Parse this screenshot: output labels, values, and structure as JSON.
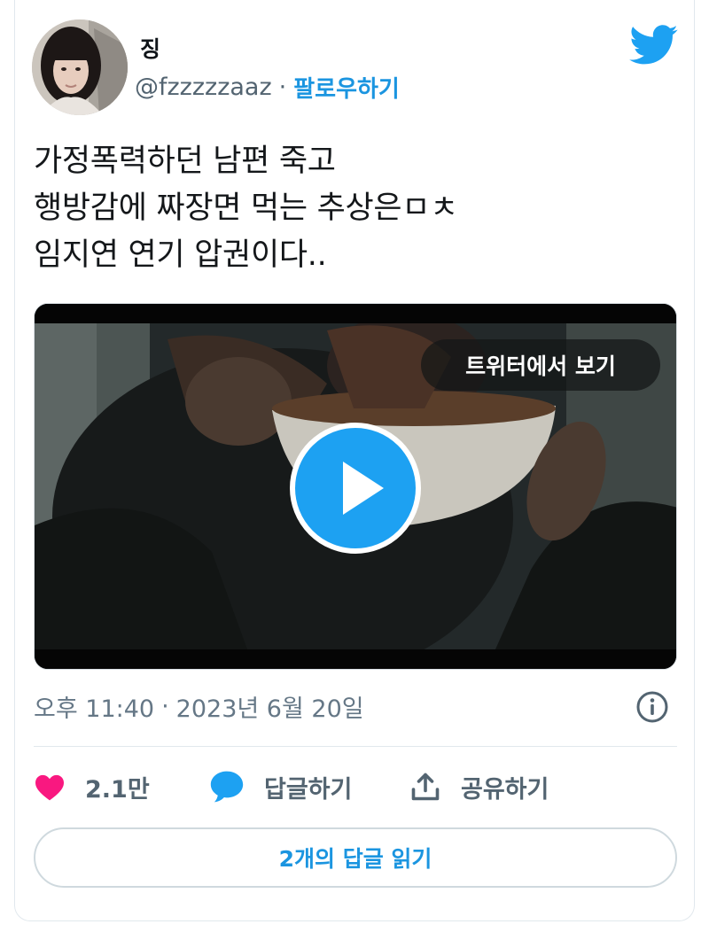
{
  "author": {
    "name": "징",
    "handle": "@fzzzzzaaz",
    "separator": "·",
    "follow_label": "팔로우하기"
  },
  "tweet": {
    "lines": [
      "가정폭력하던 남편 죽고",
      "행방감에 짜장면 먹는 추상은ㅁㅊ",
      "임지연 연기 압권이다.."
    ]
  },
  "media": {
    "view_on_twitter_label": "트위터에서 보기",
    "play_icon": "play-icon"
  },
  "meta": {
    "time": "오후 11:40",
    "separator": "·",
    "date": "2023년 6월 20일",
    "info_icon": "info-icon"
  },
  "actions": {
    "like_count": "2.1만",
    "reply_label": "답글하기",
    "share_label": "공유하기"
  },
  "read_replies_label": "2개의 답글 읽기",
  "colors": {
    "accent": "#1b95e0",
    "play_button": "#1da1f2",
    "heart": "#f91880",
    "secondary_text": "#657786",
    "border": "#e1e8ed"
  }
}
